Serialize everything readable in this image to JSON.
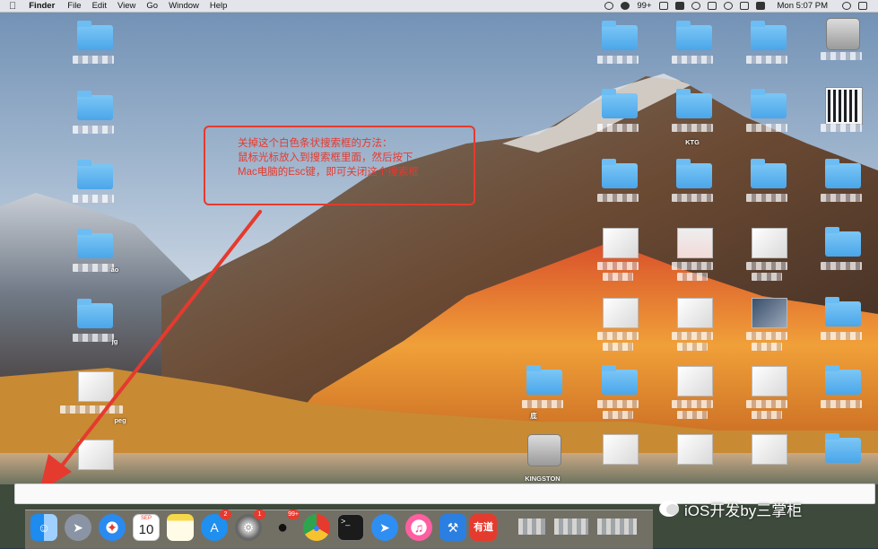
{
  "menubar": {
    "apple_icon": "apple-icon",
    "app_name": "Finder",
    "menus": [
      "File",
      "Edit",
      "View",
      "Go",
      "Window",
      "Help"
    ],
    "badge_99": "99+",
    "clock": "Mon 5:07 PM"
  },
  "annotation": {
    "line1": "关掉这个白色条状搜索框的方法：",
    "line2": "鼠标光标放入到搜索框里面，然后按下",
    "line3": "Mac电脑的Esc键，即可关闭这个搜索框"
  },
  "desktop": {
    "kingston_label": "KINGSTON",
    "partial_labels": [
      "ao",
      "jg",
      "peg",
      "eg",
      "底",
      "KTG"
    ]
  },
  "dock": {
    "appstore_badge": "2",
    "sysprefs_badge": "1",
    "qq_badge": "99+",
    "calendar_month": "SEP",
    "calendar_day": "10",
    "terminal_prompt": ">_",
    "youdao_label": "有道"
  },
  "watermark": {
    "text": "iOS开发by三掌柜"
  },
  "colors": {
    "annotation_red": "#e53a2e",
    "folder_blue": "#4aa6ea"
  }
}
